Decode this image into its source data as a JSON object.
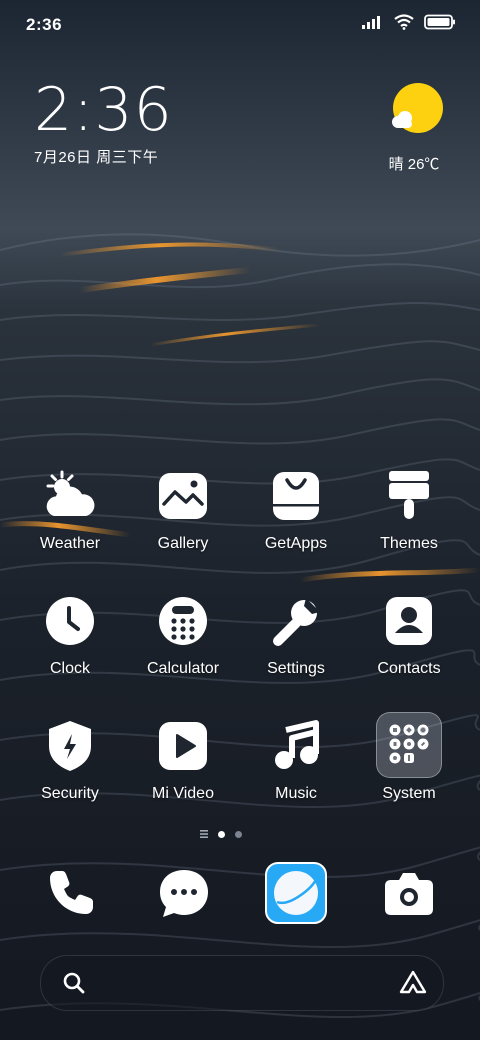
{
  "status_bar": {
    "time": "2:36"
  },
  "clock_widget": {
    "time": "2:36",
    "date": "7月26日 周三下午"
  },
  "weather_widget": {
    "condition": "晴",
    "temperature": "26℃"
  },
  "apps": {
    "weather": {
      "label": "Weather",
      "icon": "weather-icon"
    },
    "gallery": {
      "label": "Gallery",
      "icon": "gallery-icon"
    },
    "getapps": {
      "label": "GetApps",
      "icon": "getapps-icon"
    },
    "themes": {
      "label": "Themes",
      "icon": "themes-icon"
    },
    "clock": {
      "label": "Clock",
      "icon": "clock-icon"
    },
    "calculator": {
      "label": "Calculator",
      "icon": "calculator-icon"
    },
    "settings": {
      "label": "Settings",
      "icon": "settings-icon"
    },
    "contacts": {
      "label": "Contacts",
      "icon": "contacts-icon"
    },
    "security": {
      "label": "Security",
      "icon": "security-icon"
    },
    "mivideo": {
      "label": "Mi Video",
      "icon": "mi-video-icon"
    },
    "music": {
      "label": "Music",
      "icon": "music-icon"
    },
    "system": {
      "label": "System",
      "icon": "folder-icon"
    }
  },
  "page_indicator": {
    "pages": 2,
    "current": 1
  },
  "dock": [
    "phone-icon",
    "messaging-icon",
    "browser-icon",
    "camera-icon"
  ],
  "colors": {
    "sun": "#FDD10F",
    "browser_blue": "#27A9F5",
    "wallpaper_orange": "#F29A2E"
  }
}
